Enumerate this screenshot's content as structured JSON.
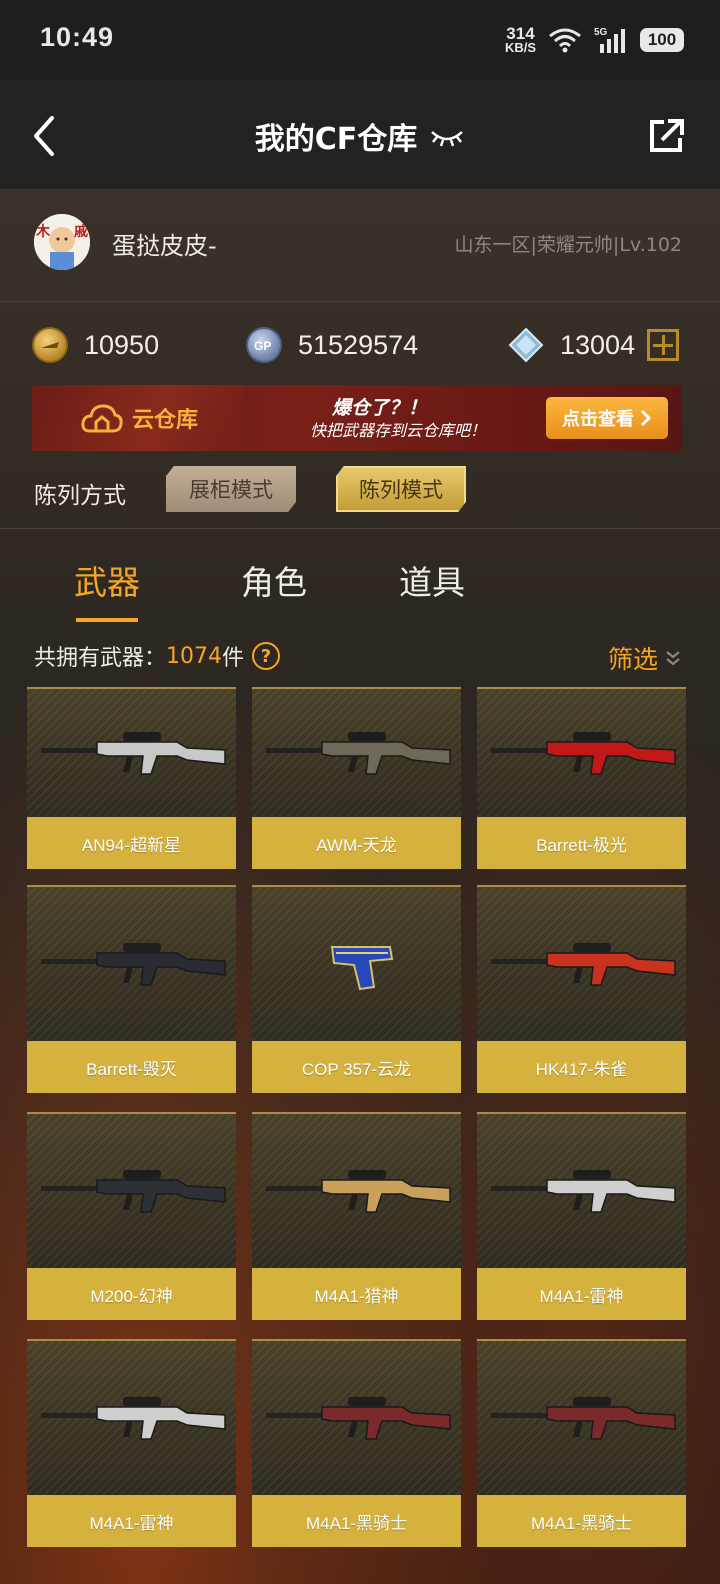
{
  "status_bar": {
    "time": "10:49",
    "net_speed_value": "314",
    "net_speed_unit": "KB/S",
    "network": "5G",
    "battery": "100"
  },
  "header": {
    "title": "我的CF仓库",
    "back_icon": "back-arrow-icon",
    "share_icon": "share-icon",
    "eye_icon": "eye-closed-icon"
  },
  "profile": {
    "username": "蛋挞皮皮-",
    "server_info": "山东一区|荣耀元帅|Lv.102"
  },
  "currencies": [
    {
      "name": "cf-coin",
      "value": "10950"
    },
    {
      "name": "gp-coin",
      "value": "51529574"
    },
    {
      "name": "diamond",
      "value": "13004"
    }
  ],
  "banner": {
    "cloud_label": "云仓库",
    "line1": "爆仓了？！",
    "line2": "快把武器存到云仓库吧！",
    "cta": "点击查看"
  },
  "display_mode": {
    "label": "陈列方式",
    "cabinet": "展柜模式",
    "list": "陈列模式",
    "active": "list"
  },
  "tabs": [
    {
      "label": "武器",
      "active": true
    },
    {
      "label": "角色",
      "active": false
    },
    {
      "label": "道具",
      "active": false
    }
  ],
  "summary": {
    "prefix": "共拥有武器：",
    "count": "1074",
    "suffix": "件",
    "filter": "筛选"
  },
  "weapons": [
    {
      "name": "AN94-超新星",
      "color": "#c8c8c8"
    },
    {
      "name": "AWM-天龙",
      "color": "#6e6a5a"
    },
    {
      "name": "Barrett-极光",
      "color": "#c21818"
    },
    {
      "name": "Barrett-毁灭",
      "color": "#2b2b33"
    },
    {
      "name": "COP 357-云龙",
      "color": "#2748b8"
    },
    {
      "name": "HK417-朱雀",
      "color": "#c8321e"
    },
    {
      "name": "M200-幻神",
      "color": "#2e3038"
    },
    {
      "name": "M4A1-猎神",
      "color": "#c9a15a"
    },
    {
      "name": "M4A1-雷神",
      "color": "#cfcfcf"
    },
    {
      "name": "M4A1-雷神",
      "color": "#cfcfcf"
    },
    {
      "name": "M4A1-黑骑士",
      "color": "#7a2a2a"
    },
    {
      "name": "M4A1-黑骑士",
      "color": "#7a2a2a"
    }
  ],
  "colors": {
    "accent": "#f6a623",
    "card_label": "#d4b23d",
    "header_bg": "#232221"
  }
}
